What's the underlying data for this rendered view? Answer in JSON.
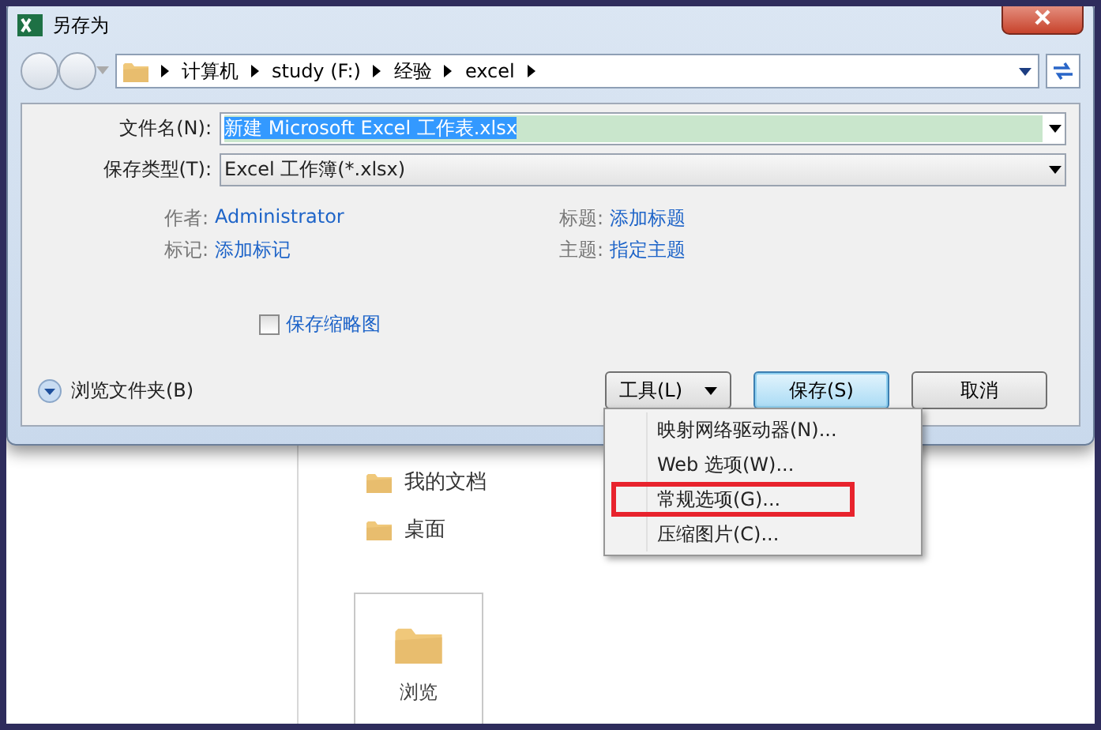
{
  "window": {
    "title": "另存为"
  },
  "address": {
    "crumbs": [
      "计算机",
      "study (F:)",
      "经验",
      "excel"
    ]
  },
  "fields": [
    {
      "label": "文件名(N):",
      "value": "新建 Microsoft Excel 工作表.xlsx",
      "selected": true
    },
    {
      "label": "保存类型(T):",
      "value": "Excel 工作簿(*.xlsx)",
      "selected": false
    }
  ],
  "metadata": [
    {
      "label": "作者:",
      "value": "Administrator"
    },
    {
      "label": "标题:",
      "value": "添加标题"
    },
    {
      "label": "标记:",
      "value": "添加标记"
    },
    {
      "label": "主题:",
      "value": "指定主题"
    }
  ],
  "thumbnail_checkbox": {
    "label": "保存缩略图",
    "checked": false
  },
  "browse_folders": {
    "label": "浏览文件夹(B)"
  },
  "buttons": [
    {
      "label": "工具(L)",
      "kind": "dropdown"
    },
    {
      "label": "保存(S)",
      "kind": "default"
    },
    {
      "label": "取消",
      "kind": "plain"
    }
  ],
  "tools_menu": [
    {
      "label": "映射网络驱动器(N)...",
      "highlighted": false
    },
    {
      "label": "Web 选项(W)...",
      "highlighted": false
    },
    {
      "label": "常规选项(G)...",
      "highlighted": true
    },
    {
      "label": "压缩图片(C)...",
      "highlighted": false
    }
  ],
  "backstage": {
    "places": [
      "我的文档",
      "桌面"
    ],
    "browse_tile": "浏览"
  }
}
